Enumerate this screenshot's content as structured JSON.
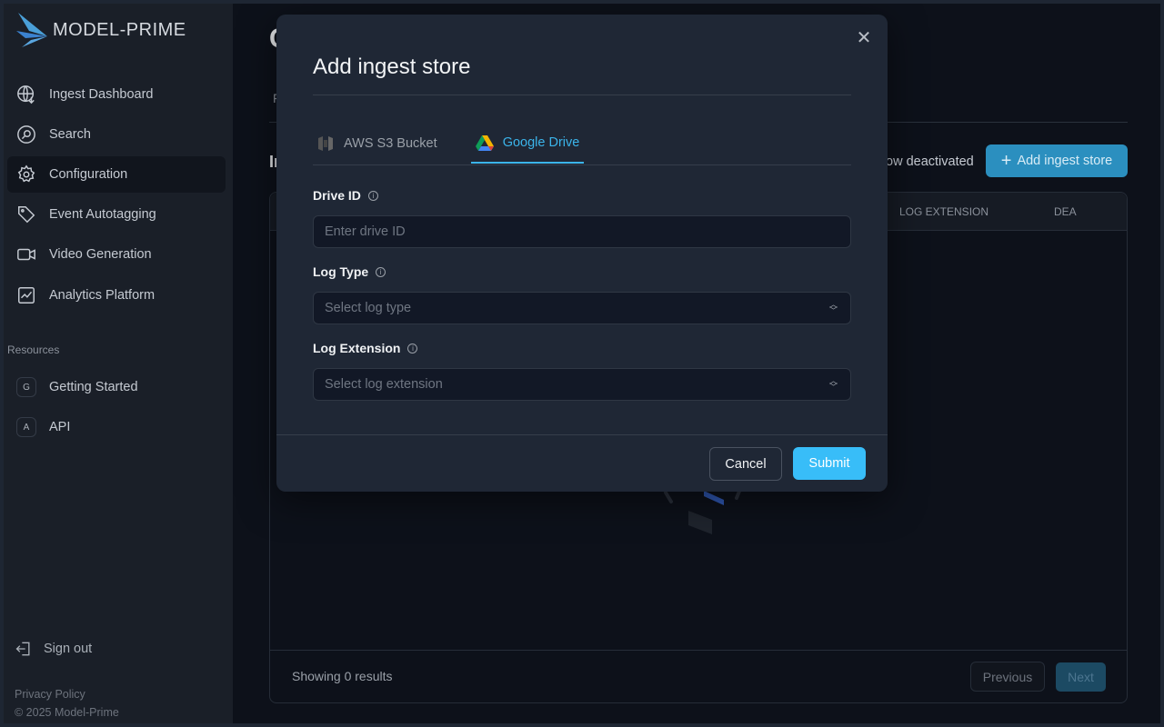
{
  "brand": {
    "name": "MODEL-PRIME"
  },
  "sidebar": {
    "items": [
      {
        "label": "Ingest Dashboard",
        "icon": "globe-download-icon"
      },
      {
        "label": "Search",
        "icon": "search-icon"
      },
      {
        "label": "Configuration",
        "icon": "gear-icon",
        "active": true
      },
      {
        "label": "Event Autotagging",
        "icon": "tag-icon"
      },
      {
        "label": "Video Generation",
        "icon": "video-icon"
      },
      {
        "label": "Analytics Platform",
        "icon": "chart-icon"
      }
    ],
    "resources_label": "Resources",
    "resources": [
      {
        "badge": "G",
        "label": "Getting Started"
      },
      {
        "badge": "A",
        "label": "API"
      }
    ],
    "sign_out": "Sign out",
    "privacy": "Privacy Policy",
    "copyright": "© 2025 Model-Prime"
  },
  "background": {
    "title_fragment": "C",
    "tab_fragment": "F",
    "heading_fragment": "In",
    "show_deactivated_fragment": "ow deactivated",
    "add_button": "Add ingest store",
    "columns": [
      "LOG EXTENSION",
      "DEA"
    ],
    "showing": "Showing 0 results",
    "previous": "Previous",
    "next": "Next"
  },
  "modal": {
    "title": "Add ingest store",
    "tabs": [
      {
        "label": "AWS S3 Bucket",
        "icon": "aws-s3-icon"
      },
      {
        "label": "Google Drive",
        "icon": "google-drive-icon",
        "active": true
      }
    ],
    "fields": {
      "drive_id": {
        "label": "Drive ID",
        "placeholder": "Enter drive ID",
        "value": ""
      },
      "log_type": {
        "label": "Log Type",
        "placeholder": "Select log type"
      },
      "log_extension": {
        "label": "Log Extension",
        "placeholder": "Select log extension"
      }
    },
    "cancel": "Cancel",
    "submit": "Submit"
  },
  "colors": {
    "accent": "#38bdf8",
    "active_tab": "#3bb4ea",
    "modal_bg": "#1f2735",
    "sidebar_bg": "#1a1f28"
  }
}
